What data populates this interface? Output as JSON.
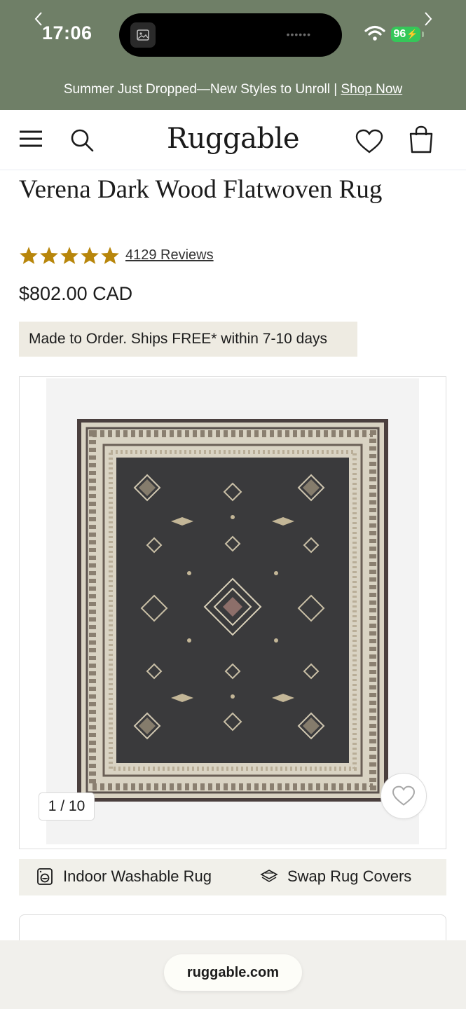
{
  "status_bar": {
    "time": "17:06",
    "battery": "96"
  },
  "promo": {
    "text": "Summer Just Dropped—New Styles to Unroll | ",
    "link": "Shop Now"
  },
  "nav": {
    "logo": "Ruggable"
  },
  "product": {
    "title": "Verena Dark Wood Flatwoven Rug",
    "rating": 5,
    "reviews": "4129 Reviews",
    "price": "$802.00 CAD",
    "shipping": "Made to Order. Ships FREE* within 7-10 days"
  },
  "gallery": {
    "counter": "1 / 10"
  },
  "features": {
    "washable": "Indoor Washable Rug",
    "swap": "Swap Rug Covers"
  },
  "browser": {
    "url": "ruggable.com"
  },
  "colors": {
    "banner_green": "#6f7f67",
    "star_gold": "#b8860b",
    "badge_beige": "#eeebe2",
    "rug_field": "#3a3a3c",
    "rug_border": "#d9d3c3"
  }
}
